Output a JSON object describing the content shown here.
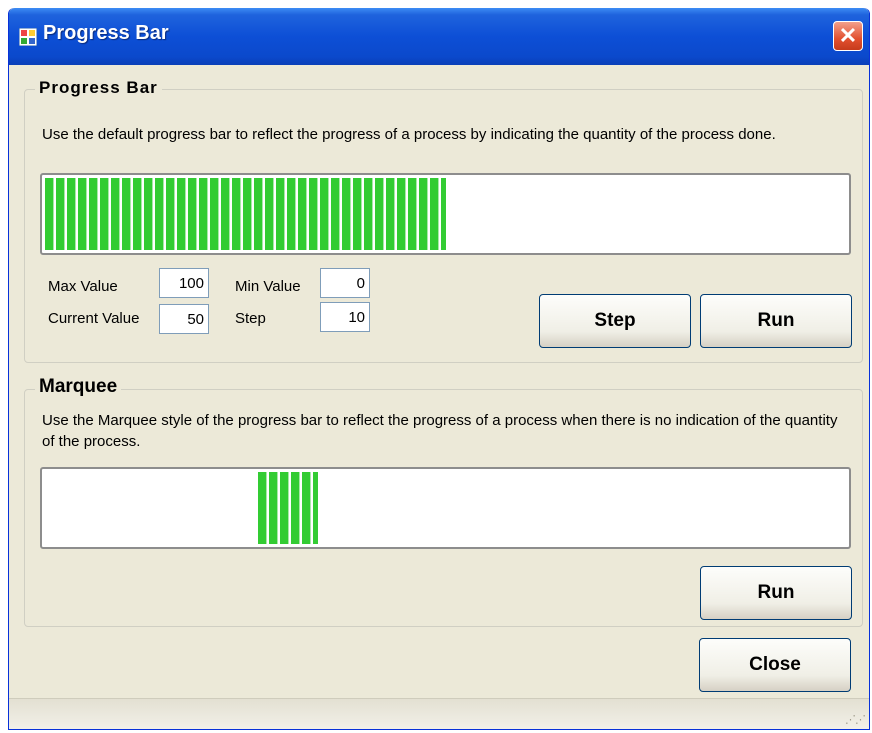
{
  "window": {
    "title": "Progress Bar",
    "close_glyph": "✕"
  },
  "progress_group": {
    "title": "Progress Bar",
    "description": "Use the default progress bar to reflect the progress of a process by indicating the quantity of the process done.",
    "progress_fraction": 0.5,
    "fields": {
      "max_label": "Max Value",
      "max_value": "100",
      "min_label": "Min Value",
      "min_value": "0",
      "current_label": "Current Value",
      "current_value": "50",
      "step_label": "Step",
      "step_value": "10"
    },
    "step_button": "Step",
    "run_button": "Run"
  },
  "marquee_group": {
    "title": "Marquee",
    "description": "Use the Marquee style of the progress bar to reflect the progress of a process when there is no indication of the quantity of the process.",
    "run_button": "Run"
  },
  "close_button": "Close",
  "colors": {
    "progress_fill": "#33cc33",
    "titlebar": "#0d4fd6",
    "window_bg": "#ece9d8"
  }
}
